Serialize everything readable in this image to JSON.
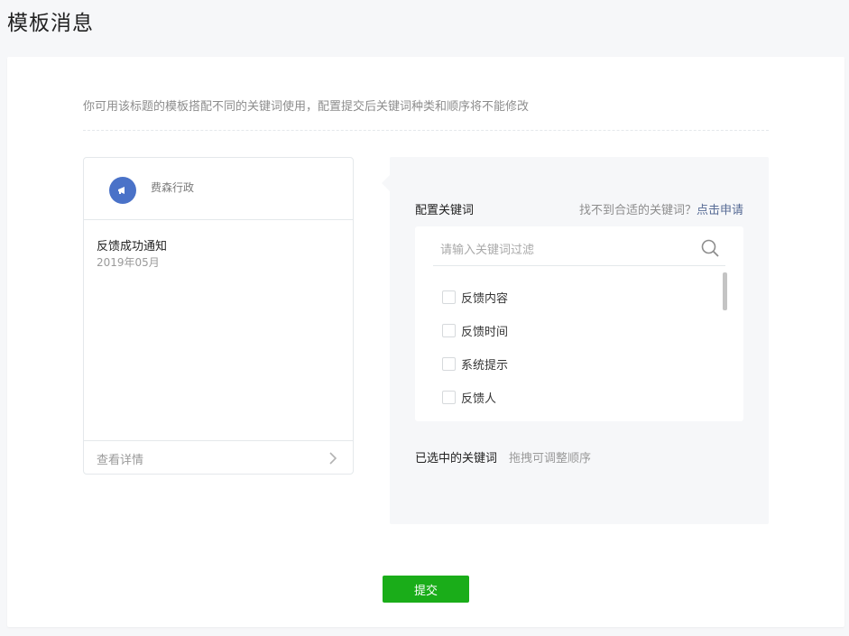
{
  "page": {
    "title": "模板消息"
  },
  "tip": "你可用该标题的模板搭配不同的关键词使用，配置提交后关键词种类和顺序将不能修改",
  "preview": {
    "account_name": "费森行政",
    "avatar_icon": "megaphone-icon",
    "message_title": "反馈成功通知",
    "message_date": "2019年05月",
    "detail_link": "查看详情",
    "arrow_icon": "chevron-right-icon"
  },
  "config": {
    "label": "配置关键词",
    "hint_text": "找不到合适的关键词？",
    "apply_link": "点击申请",
    "filter_placeholder": "请输入关键词过滤",
    "search_icon": "search-icon",
    "keywords": [
      {
        "label": "反馈内容",
        "checked": false
      },
      {
        "label": "反馈时间",
        "checked": false
      },
      {
        "label": "系统提示",
        "checked": false
      },
      {
        "label": "反馈人",
        "checked": false
      }
    ],
    "selected_label": "已选中的关键词",
    "selected_hint": "拖拽可调整顺序"
  },
  "submit_label": "提交",
  "colors": {
    "accent_green": "#1aad19",
    "link_blue": "#576b95",
    "avatar_blue": "#4a72c8"
  }
}
